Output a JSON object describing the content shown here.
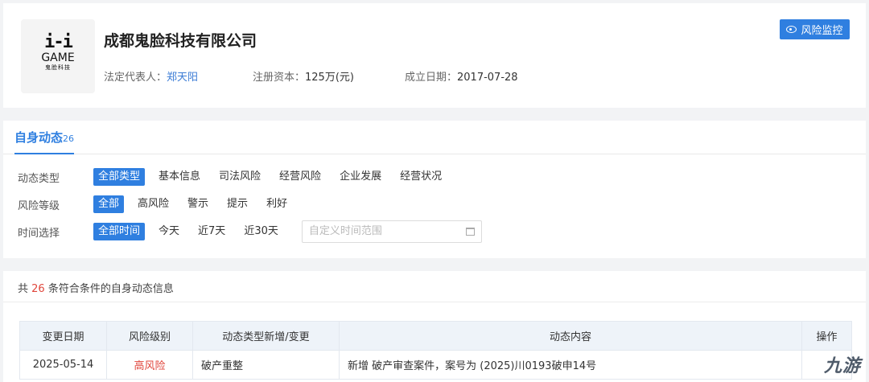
{
  "company": {
    "logo_text_top": "i-i",
    "logo_text_game": "GAME",
    "logo_text_cn": "鬼脸科技",
    "name": "成都鬼脸科技有限公司",
    "legal_rep_label": "法定代表人：",
    "legal_rep_value": "郑天阳",
    "capital_label": "注册资本：",
    "capital_value": "125万(元)",
    "founded_label": "成立日期：",
    "founded_value": "2017-07-28",
    "monitor_button": "风险监控"
  },
  "tab": {
    "label": "自身动态",
    "count": "26"
  },
  "filters": {
    "type_label": "动态类型",
    "type_options": [
      "全部类型",
      "基本信息",
      "司法风险",
      "经营风险",
      "企业发展",
      "经营状况"
    ],
    "risk_label": "风险等级",
    "risk_options": [
      "全部",
      "高风险",
      "警示",
      "提示",
      "利好"
    ],
    "time_label": "时间选择",
    "time_options": [
      "全部时间",
      "今天",
      "近7天",
      "近30天"
    ],
    "date_placeholder": "自定义时间范围"
  },
  "results": {
    "prefix": "共 ",
    "count": "26",
    "suffix": " 条符合条件的自身动态信息",
    "columns": [
      "变更日期",
      "风险级别",
      "动态类型新增/变更",
      "动态内容",
      "操作"
    ],
    "rows": [
      {
        "date": "2025-05-14",
        "risk": "高风险",
        "type": "破产重整",
        "content": "新增 破产审查案件，案号为 (2025)川0193破申14号"
      }
    ]
  },
  "watermark": "九游",
  "colors": {
    "accent": "#2f7fe0",
    "danger": "#e0463c"
  }
}
